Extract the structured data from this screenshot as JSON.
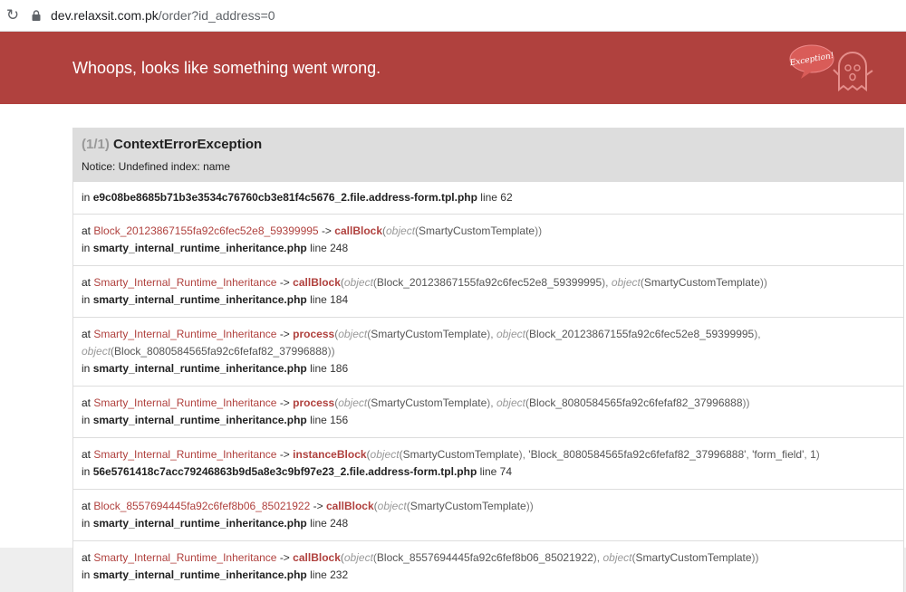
{
  "browser": {
    "url_host": "dev.relaxsit.com.pk",
    "url_path": "/order?id_address=0"
  },
  "banner": {
    "title": "Whoops, looks like something went wrong.",
    "mascot_text": "Exception!"
  },
  "exception": {
    "count": "(1/1)",
    "class": "ContextErrorException",
    "message": "Notice: Undefined index: name"
  },
  "trace": {
    "first": {
      "in": "in",
      "file": "e9c08be8685b71b3e3534c76760cb3e81f4c5676_2.file.address-form.tpl.php",
      "line": "line 62"
    },
    "frames": [
      {
        "at": "at",
        "cls": "Block_20123867155fa92c6fec52e8_59399995",
        "arrow": "->",
        "method": "callBlock",
        "args": [
          {
            "k": "object",
            "v": "SmartyCustomTemplate"
          }
        ],
        "in": "in",
        "file": "smarty_internal_runtime_inheritance.php",
        "line": "line 248"
      },
      {
        "at": "at",
        "cls": "Smarty_Internal_Runtime_Inheritance",
        "arrow": "->",
        "method": "callBlock",
        "args": [
          {
            "k": "object",
            "v": "Block_20123867155fa92c6fec52e8_59399995"
          },
          {
            "k": "object",
            "v": "SmartyCustomTemplate"
          }
        ],
        "in": "in",
        "file": "smarty_internal_runtime_inheritance.php",
        "line": "line 184"
      },
      {
        "at": "at",
        "cls": "Smarty_Internal_Runtime_Inheritance",
        "arrow": "->",
        "method": "process",
        "args": [
          {
            "k": "object",
            "v": "SmartyCustomTemplate"
          },
          {
            "k": "object",
            "v": "Block_20123867155fa92c6fec52e8_59399995"
          },
          {
            "k": "object",
            "v": "Block_8080584565fa92c6fefaf82_37996888"
          }
        ],
        "in": "in",
        "file": "smarty_internal_runtime_inheritance.php",
        "line": "line 186"
      },
      {
        "at": "at",
        "cls": "Smarty_Internal_Runtime_Inheritance",
        "arrow": "->",
        "method": "process",
        "args": [
          {
            "k": "object",
            "v": "SmartyCustomTemplate"
          },
          {
            "k": "object",
            "v": "Block_8080584565fa92c6fefaf82_37996888"
          }
        ],
        "in": "in",
        "file": "smarty_internal_runtime_inheritance.php",
        "line": "line 156"
      },
      {
        "at": "at",
        "cls": "Smarty_Internal_Runtime_Inheritance",
        "arrow": "->",
        "method": "instanceBlock",
        "args": [
          {
            "k": "object",
            "v": "SmartyCustomTemplate"
          },
          {
            "k": "",
            "v": "'Block_8080584565fa92c6fefaf82_37996888'"
          },
          {
            "k": "",
            "v": "'form_field'"
          },
          {
            "k": "",
            "v": "1"
          }
        ],
        "in": "in",
        "file": "56e5761418c7acc79246863b9d5a8e3c9bf97e23_2.file.address-form.tpl.php",
        "line": "line 74"
      },
      {
        "at": "at",
        "cls": "Block_8557694445fa92c6fef8b06_85021922",
        "arrow": "->",
        "method": "callBlock",
        "args": [
          {
            "k": "object",
            "v": "SmartyCustomTemplate"
          }
        ],
        "in": "in",
        "file": "smarty_internal_runtime_inheritance.php",
        "line": "line 248"
      },
      {
        "at": "at",
        "cls": "Smarty_Internal_Runtime_Inheritance",
        "arrow": "->",
        "method": "callBlock",
        "args": [
          {
            "k": "object",
            "v": "Block_8557694445fa92c6fef8b06_85021922"
          },
          {
            "k": "object",
            "v": "SmartyCustomTemplate"
          }
        ],
        "in": "in",
        "file": "smarty_internal_runtime_inheritance.php",
        "line": "line 232"
      }
    ]
  },
  "colors": {
    "banner": "#b0413e",
    "panel_head": "#dddddd"
  },
  "icons": {
    "reload": "reload-icon",
    "lock": "lock-icon",
    "mascot": "exception-ghost-icon"
  }
}
